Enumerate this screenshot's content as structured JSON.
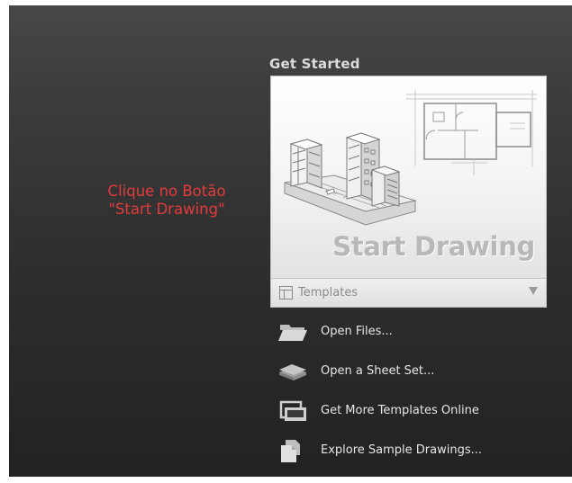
{
  "get_started": {
    "title": "Get Started",
    "start_drawing_label": "Start Drawing",
    "templates_label": "Templates"
  },
  "instruction": {
    "line1": "Clique no Botão",
    "line2": "\"Start Drawing\"",
    "color": "#e23b3b"
  },
  "links": [
    {
      "label": "Open Files...",
      "icon": "folder-icon"
    },
    {
      "label": "Open a Sheet Set...",
      "icon": "sheet-set-icon"
    },
    {
      "label": "Get More Templates Online",
      "icon": "templates-online-icon"
    },
    {
      "label": "Explore Sample Drawings...",
      "icon": "sample-drawings-icon"
    }
  ]
}
